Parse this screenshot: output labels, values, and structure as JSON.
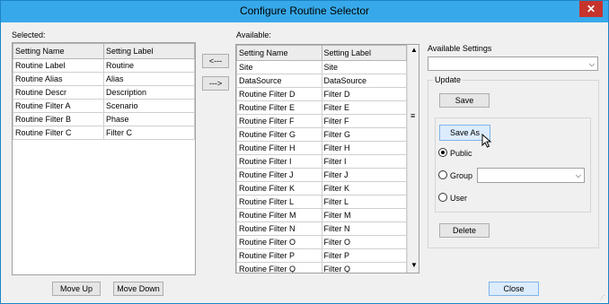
{
  "window": {
    "title": "Configure Routine Selector",
    "close_glyph": "✕"
  },
  "selected": {
    "label": "Selected:",
    "columns": [
      "Setting Name",
      "Setting Label"
    ],
    "rows": [
      [
        "Routine Label",
        "Routine"
      ],
      [
        "Routine Alias",
        "Alias"
      ],
      [
        "Routine Descr",
        "Description"
      ],
      [
        "Routine Filter A",
        "Scenario"
      ],
      [
        "Routine Filter B",
        "Phase"
      ],
      [
        "Routine Filter C",
        "Filter C"
      ]
    ]
  },
  "transfer": {
    "to_selected": "<---",
    "to_available": "--->"
  },
  "available": {
    "label": "Available:",
    "columns": [
      "Setting Name",
      "Setting Label"
    ],
    "rows": [
      [
        "Site",
        "Site"
      ],
      [
        "DataSource",
        "DataSource"
      ],
      [
        "Routine Filter D",
        "Filter D"
      ],
      [
        "Routine Filter E",
        "Filter E"
      ],
      [
        "Routine Filter F",
        "Filter F"
      ],
      [
        "Routine Filter G",
        "Filter G"
      ],
      [
        "Routine Filter H",
        "Filter H"
      ],
      [
        "Routine Filter I",
        "Filter I"
      ],
      [
        "Routine Filter J",
        "Filter J"
      ],
      [
        "Routine Filter K",
        "Filter K"
      ],
      [
        "Routine Filter L",
        "Filter L"
      ],
      [
        "Routine Filter M",
        "Filter M"
      ],
      [
        "Routine Filter N",
        "Filter N"
      ],
      [
        "Routine Filter O",
        "Filter O"
      ],
      [
        "Routine Filter P",
        "Filter P"
      ],
      [
        "Routine Filter Q",
        "Filter Q"
      ]
    ],
    "scrollbar_icons": [
      "chevron-up-icon",
      "scroll-grip-icon",
      "chevron-down-icon"
    ]
  },
  "settings": {
    "available_settings_label": "Available Settings",
    "available_settings_value": "",
    "update_label": "Update",
    "save_label": "Save",
    "save_as_label": "Save As",
    "public_label": "Public",
    "group_label": "Group",
    "group_value": "",
    "user_label": "User",
    "delete_label": "Delete",
    "selected_visibility": "Public"
  },
  "footer": {
    "move_up": "Move Up",
    "move_down": "Move Down",
    "close": "Close"
  },
  "colors": {
    "titlebar": "#37a9ea",
    "close_button": "#c7332d",
    "focus_button": "#dcecfc"
  }
}
